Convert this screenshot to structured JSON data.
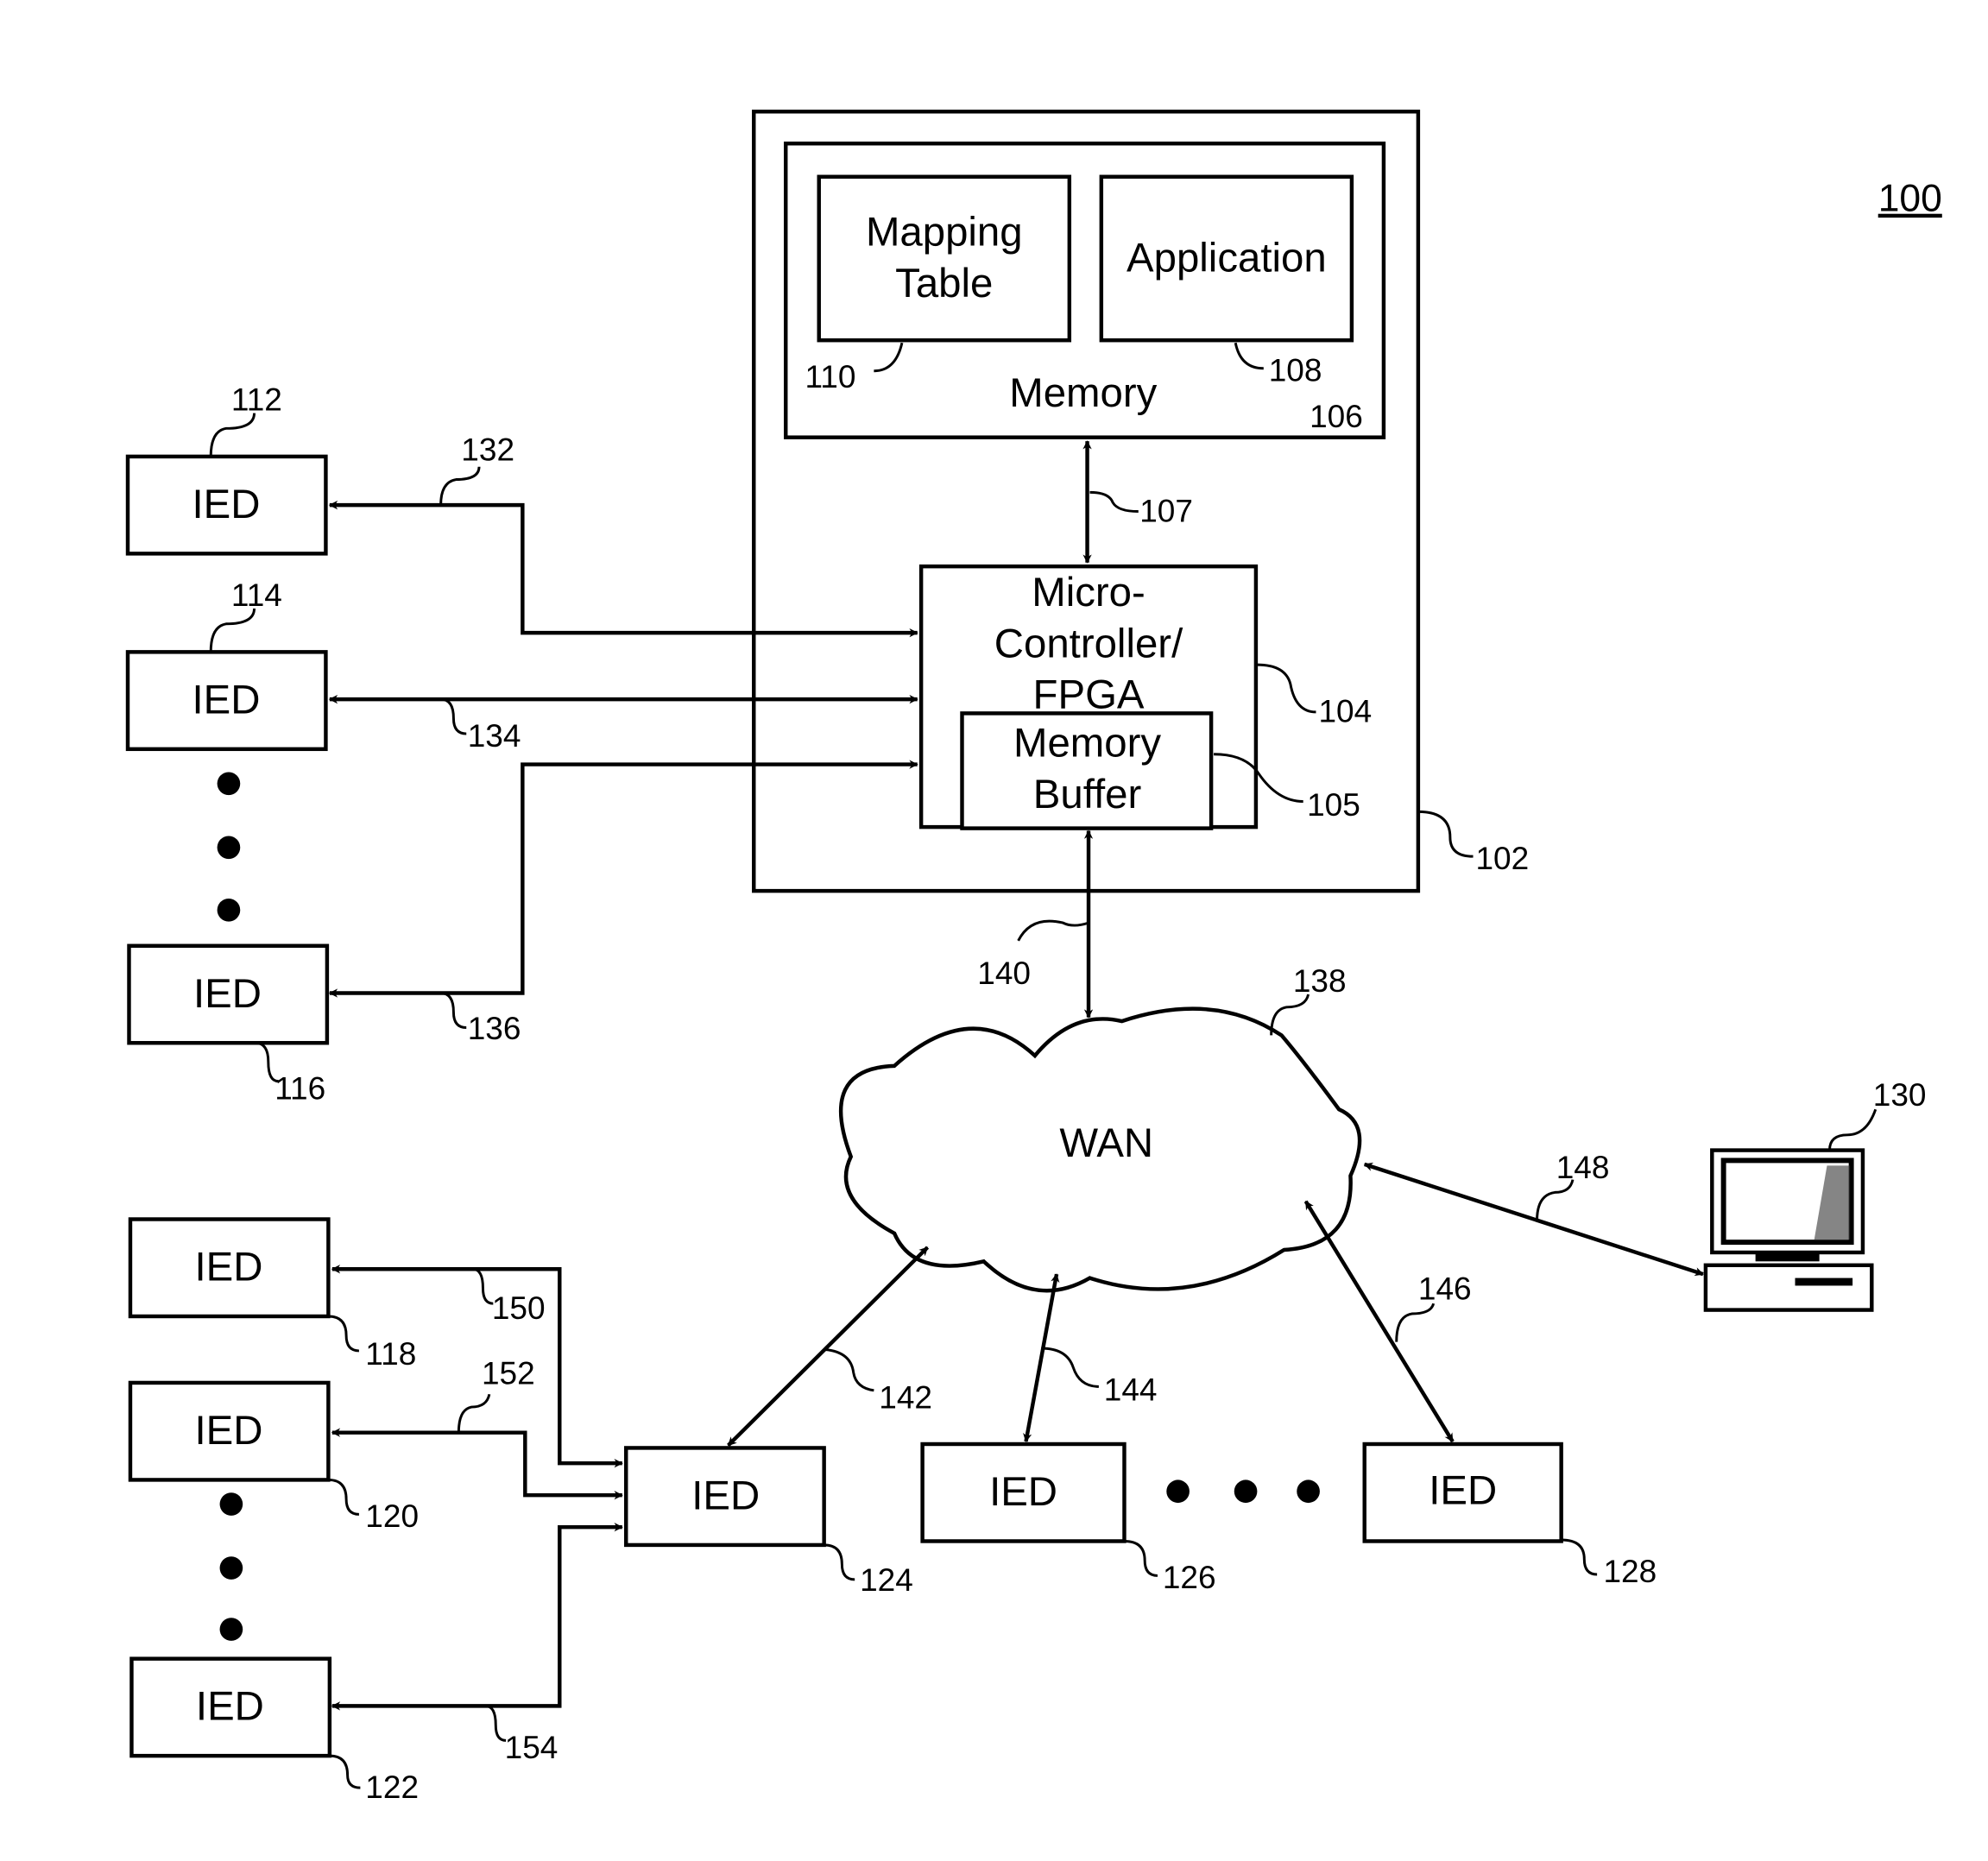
{
  "figure": {
    "number": "100"
  },
  "device": {
    "ref": "102",
    "memory": {
      "label": "Memory",
      "ref": "106",
      "mapping_table": {
        "line1": "Mapping",
        "line2": "Table",
        "ref": "110"
      },
      "application": {
        "label": "Application",
        "ref": "108"
      }
    },
    "memory_link_ref": "107",
    "controller": {
      "line1": "Micro-",
      "line2": "Controller/",
      "line3": "FPGA",
      "ref": "104"
    },
    "buffer": {
      "line1": "Memory",
      "line2": "Buffer",
      "ref": "105"
    }
  },
  "wan": {
    "label": "WAN",
    "ref": "138",
    "link_ref": "140"
  },
  "ied_label": "IED",
  "ieds": {
    "i112": "112",
    "i114": "114",
    "i116": "116",
    "i118": "118",
    "i120": "120",
    "i122": "122",
    "i124": "124",
    "i126": "126",
    "i128": "128"
  },
  "links": {
    "l132": "132",
    "l134": "134",
    "l136": "136",
    "l142": "142",
    "l144": "144",
    "l146": "146",
    "l148": "148",
    "l150": "150",
    "l152": "152",
    "l154": "154"
  },
  "computer": {
    "ref": "130"
  }
}
